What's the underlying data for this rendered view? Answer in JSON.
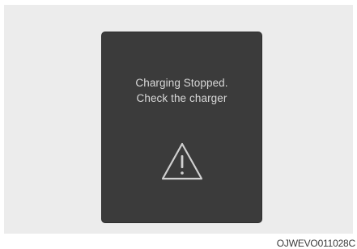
{
  "dialog": {
    "line1": "Charging Stopped.",
    "line2": "Check the charger",
    "icon": "warning-triangle-icon"
  },
  "caption": "OJWEVO011028C",
  "colors": {
    "panel": "#3b3b3b",
    "text": "#d8d8d8",
    "icon": "#d0d0d0",
    "backdrop": "#ececec"
  }
}
